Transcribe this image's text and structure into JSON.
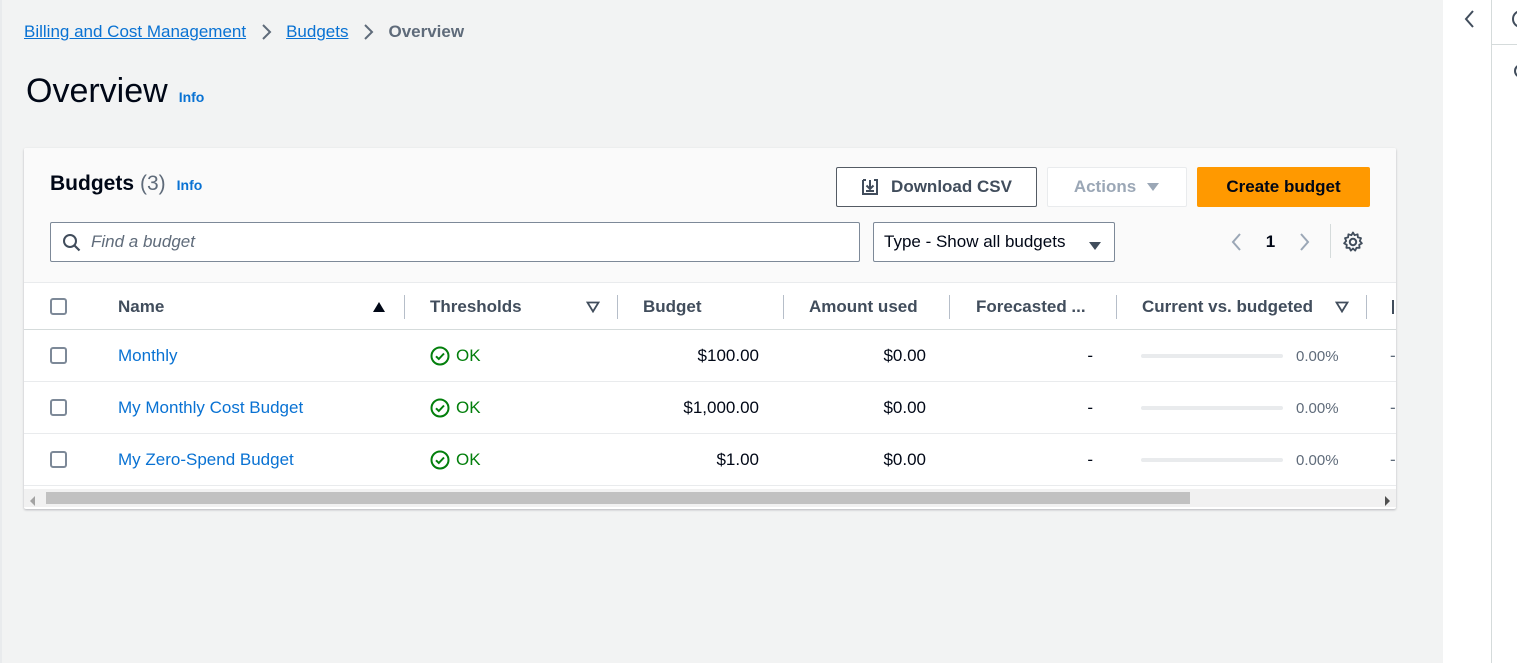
{
  "breadcrumb": {
    "items": [
      "Billing and Cost Management",
      "Budgets"
    ],
    "current": "Overview"
  },
  "page": {
    "title": "Overview",
    "info": "Info"
  },
  "budgets_panel": {
    "title": "Budgets",
    "count": "(3)",
    "info": "Info",
    "download_label": "Download CSV",
    "actions_label": "Actions",
    "create_label": "Create budget",
    "search_placeholder": "Find a budget",
    "type_filter": "Type - Show all budgets",
    "page_number": "1"
  },
  "table": {
    "columns": [
      "Name",
      "Thresholds",
      "Budget",
      "Amount used",
      "Forecasted ...",
      "Current vs. budgeted"
    ],
    "rows": [
      {
        "name": "Monthly",
        "threshold": "OK",
        "budget": "$100.00",
        "amount_used": "$0.00",
        "forecasted": "-",
        "current_vs_budgeted": "0.00%",
        "progress": 0,
        "next": "-"
      },
      {
        "name": "My Monthly Cost Budget",
        "threshold": "OK",
        "budget": "$1,000.00",
        "amount_used": "$0.00",
        "forecasted": "-",
        "current_vs_budgeted": "0.00%",
        "progress": 0,
        "next": "-"
      },
      {
        "name": "My Zero-Spend Budget",
        "threshold": "OK",
        "budget": "$1.00",
        "amount_used": "$0.00",
        "forecasted": "-",
        "current_vs_budgeted": "0.00%",
        "progress": 0,
        "next": "-"
      }
    ]
  },
  "icons": {
    "breadcrumb_separator": "chevron-right-icon",
    "download": "download-icon",
    "actions_caret": "caret-down-icon",
    "search": "search-icon",
    "type_caret": "caret-down-icon",
    "pager_prev": "chevron-left-icon",
    "pager_next": "chevron-right-icon",
    "settings": "gear-icon",
    "status_ok": "check-circle-icon",
    "sort_asc": "caret-up-filled-icon",
    "sort_none": "caret-down-outline-icon",
    "rail_collapse": "chevron-left-icon"
  },
  "colors": {
    "link": "#0972d3",
    "primary_button": "#ff9900",
    "ok_status": "#037f0c",
    "page_bg": "#f2f3f3"
  }
}
